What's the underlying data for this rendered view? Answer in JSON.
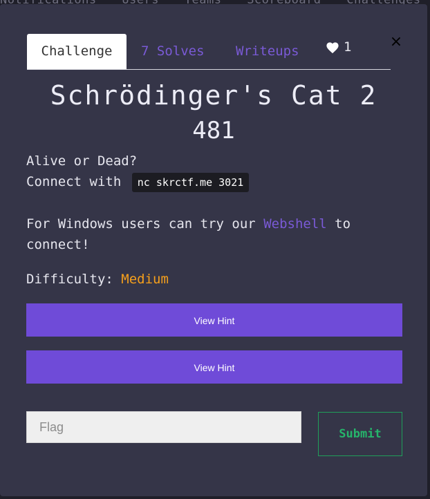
{
  "background_nav": [
    "Notifications",
    "Users",
    "Teams",
    "Scoreboard",
    "Challenges"
  ],
  "modal": {
    "close_label": "×",
    "tabs": {
      "challenge": "Challenge",
      "solves": "7 Solves",
      "writeups": "Writeups",
      "likes": "1"
    },
    "title": "Schrödinger's Cat 2",
    "points": "481",
    "description": {
      "line1": "Alive or Dead?",
      "connect_prefix": "Connect with",
      "command": "nc skrctf.me 3021",
      "windows_prefix": "For Windows users can try our",
      "webshell_link": "Webshell",
      "windows_suffix_part1": "to",
      "windows_suffix_part2": "connect!"
    },
    "difficulty": {
      "label": "Difficulty:",
      "value": "Medium"
    },
    "hints": [
      "View Hint",
      "View Hint"
    ],
    "flag_placeholder": "Flag",
    "submit_label": "Submit"
  },
  "colors": {
    "accent": "#6f4bd8",
    "link": "#7a5ad6",
    "difficulty_medium": "#f59f1c",
    "submit": "#26b46b"
  },
  "icons": {
    "likes": "heart-icon",
    "close": "close-icon"
  }
}
